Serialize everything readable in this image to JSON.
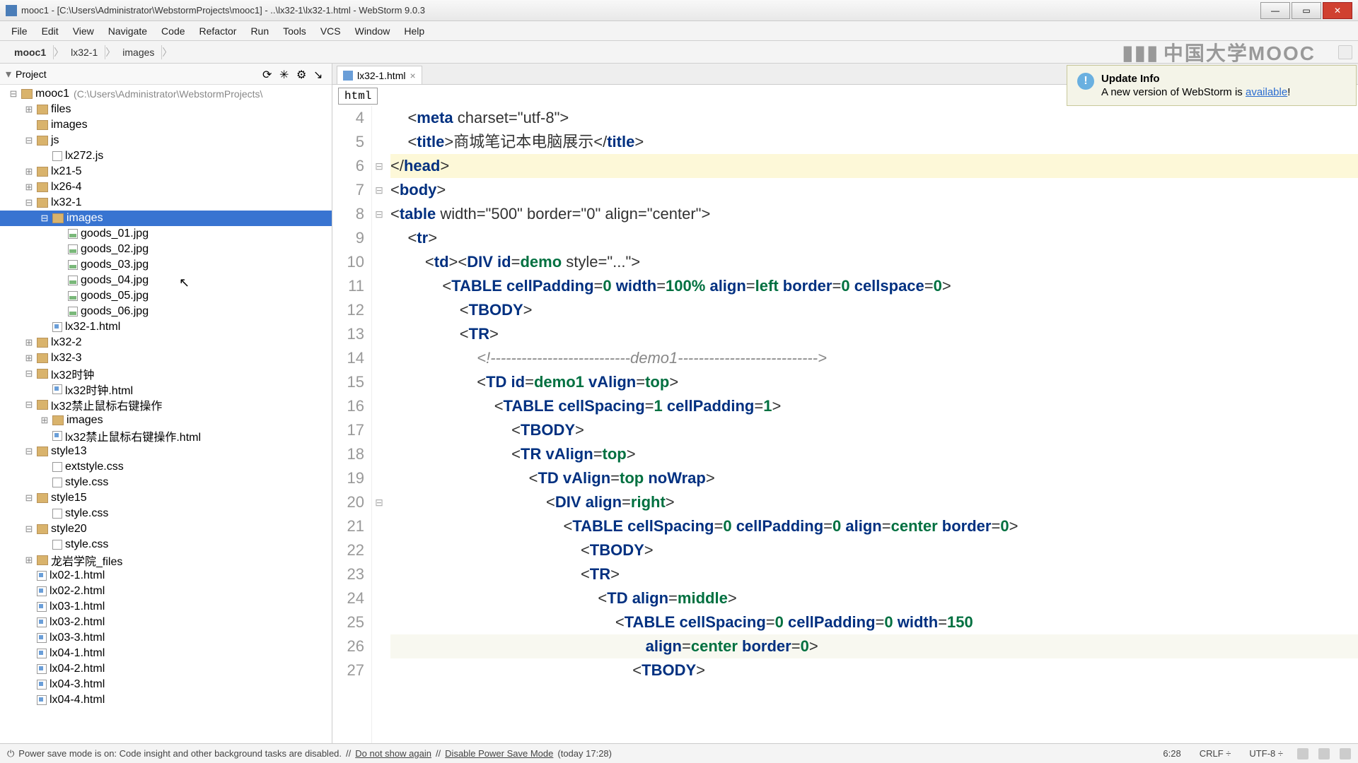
{
  "title": "mooc1 - [C:\\Users\\Administrator\\WebstormProjects\\mooc1] - ..\\lx32-1\\lx32-1.html - WebStorm 9.0.3",
  "menu": [
    "File",
    "Edit",
    "View",
    "Navigate",
    "Code",
    "Refactor",
    "Run",
    "Tools",
    "VCS",
    "Window",
    "Help"
  ],
  "breadcrumbs": [
    "mooc1",
    "lx32-1",
    "images"
  ],
  "mooc_logo": "中国大学MOOC",
  "sidebar": {
    "title": "Project",
    "root": {
      "label": "mooc1",
      "path": "(C:\\Users\\Administrator\\WebstormProjects\\"
    },
    "items": [
      {
        "depth": 1,
        "tw": "⊞",
        "kind": "folder",
        "label": "files"
      },
      {
        "depth": 1,
        "tw": "",
        "kind": "folder",
        "label": "images"
      },
      {
        "depth": 1,
        "tw": "⊟",
        "kind": "folder",
        "label": "js"
      },
      {
        "depth": 2,
        "tw": "",
        "kind": "file",
        "label": "lx272.js"
      },
      {
        "depth": 1,
        "tw": "⊞",
        "kind": "folder",
        "label": "lx21-5"
      },
      {
        "depth": 1,
        "tw": "⊞",
        "kind": "folder",
        "label": "lx26-4"
      },
      {
        "depth": 1,
        "tw": "⊟",
        "kind": "folder",
        "label": "lx32-1"
      },
      {
        "depth": 2,
        "tw": "⊟",
        "kind": "folder",
        "label": "images",
        "selected": true
      },
      {
        "depth": 3,
        "tw": "",
        "kind": "img",
        "label": "goods_01.jpg"
      },
      {
        "depth": 3,
        "tw": "",
        "kind": "img",
        "label": "goods_02.jpg"
      },
      {
        "depth": 3,
        "tw": "",
        "kind": "img",
        "label": "goods_03.jpg"
      },
      {
        "depth": 3,
        "tw": "",
        "kind": "img",
        "label": "goods_04.jpg"
      },
      {
        "depth": 3,
        "tw": "",
        "kind": "img",
        "label": "goods_05.jpg"
      },
      {
        "depth": 3,
        "tw": "",
        "kind": "img",
        "label": "goods_06.jpg"
      },
      {
        "depth": 2,
        "tw": "",
        "kind": "html",
        "label": "lx32-1.html"
      },
      {
        "depth": 1,
        "tw": "⊞",
        "kind": "folder",
        "label": "lx32-2"
      },
      {
        "depth": 1,
        "tw": "⊞",
        "kind": "folder",
        "label": "lx32-3"
      },
      {
        "depth": 1,
        "tw": "⊟",
        "kind": "folder",
        "label": "lx32时钟"
      },
      {
        "depth": 2,
        "tw": "",
        "kind": "html",
        "label": "lx32时钟.html"
      },
      {
        "depth": 1,
        "tw": "⊟",
        "kind": "folder",
        "label": "lx32禁止鼠标右键操作"
      },
      {
        "depth": 2,
        "tw": "⊞",
        "kind": "folder",
        "label": "images"
      },
      {
        "depth": 2,
        "tw": "",
        "kind": "html",
        "label": "lx32禁止鼠标右键操作.html"
      },
      {
        "depth": 1,
        "tw": "⊟",
        "kind": "folder",
        "label": "style13"
      },
      {
        "depth": 2,
        "tw": "",
        "kind": "file",
        "label": "extstyle.css"
      },
      {
        "depth": 2,
        "tw": "",
        "kind": "file",
        "label": "style.css"
      },
      {
        "depth": 1,
        "tw": "⊟",
        "kind": "folder",
        "label": "style15"
      },
      {
        "depth": 2,
        "tw": "",
        "kind": "file",
        "label": "style.css"
      },
      {
        "depth": 1,
        "tw": "⊟",
        "kind": "folder",
        "label": "style20"
      },
      {
        "depth": 2,
        "tw": "",
        "kind": "file",
        "label": "style.css"
      },
      {
        "depth": 1,
        "tw": "⊞",
        "kind": "folder",
        "label": "龙岩学院_files"
      },
      {
        "depth": 1,
        "tw": "",
        "kind": "html",
        "label": "lx02-1.html"
      },
      {
        "depth": 1,
        "tw": "",
        "kind": "html",
        "label": "lx02-2.html"
      },
      {
        "depth": 1,
        "tw": "",
        "kind": "html",
        "label": "lx03-1.html"
      },
      {
        "depth": 1,
        "tw": "",
        "kind": "html",
        "label": "lx03-2.html"
      },
      {
        "depth": 1,
        "tw": "",
        "kind": "html",
        "label": "lx03-3.html"
      },
      {
        "depth": 1,
        "tw": "",
        "kind": "html",
        "label": "lx04-1.html"
      },
      {
        "depth": 1,
        "tw": "",
        "kind": "html",
        "label": "lx04-2.html"
      },
      {
        "depth": 1,
        "tw": "",
        "kind": "html",
        "label": "lx04-3.html"
      },
      {
        "depth": 1,
        "tw": "",
        "kind": "html",
        "label": "lx04-4.html"
      }
    ]
  },
  "tab": {
    "label": "lx32-1.html"
  },
  "crumb_strip": "html",
  "code": {
    "start": 4,
    "highlight": 6,
    "caret": 26,
    "lines": [
      "    <meta charset=\"utf-8\">",
      "    <title>商城笔记本电脑展示</title>",
      "</head>",
      "<body>",
      "<table width=\"500\" border=\"0\" align=\"center\">",
      "    <tr>",
      "        <td><DIV id=demo style=\"...\">",
      "            <TABLE cellPadding=0 width=100% align=left border=0 cellspace=0>",
      "                <TBODY>",
      "                <TR>",
      "                    <!---------------------------demo1--------------------------->",
      "                    <TD id=demo1 vAlign=top>",
      "                        <TABLE cellSpacing=1 cellPadding=1>",
      "                            <TBODY>",
      "                            <TR vAlign=top>",
      "                                <TD vAlign=top noWrap>",
      "                                    <DIV align=right>",
      "                                        <TABLE cellSpacing=0 cellPadding=0 align=center border=0>",
      "                                            <TBODY>",
      "                                            <TR>",
      "                                                <TD align=middle>",
      "                                                    <TABLE cellSpacing=0 cellPadding=0 width=150",
      "                                                           align=center border=0>",
      "                                                        <TBODY>"
    ]
  },
  "notify": {
    "title": "Update Info",
    "pre": "A new version of WebStorm is ",
    "link": "available",
    "post": "!"
  },
  "status": {
    "icon": "⏻",
    "msg": "Power save mode is on: Code insight and other background tasks are disabled.",
    "sep": "//",
    "l1": "Do not show again",
    "l2": "Disable Power Save Mode",
    "time": "(today 17:28)",
    "pos": "6:28",
    "eol": "CRLF ÷",
    "enc": "UTF-8 ÷"
  }
}
